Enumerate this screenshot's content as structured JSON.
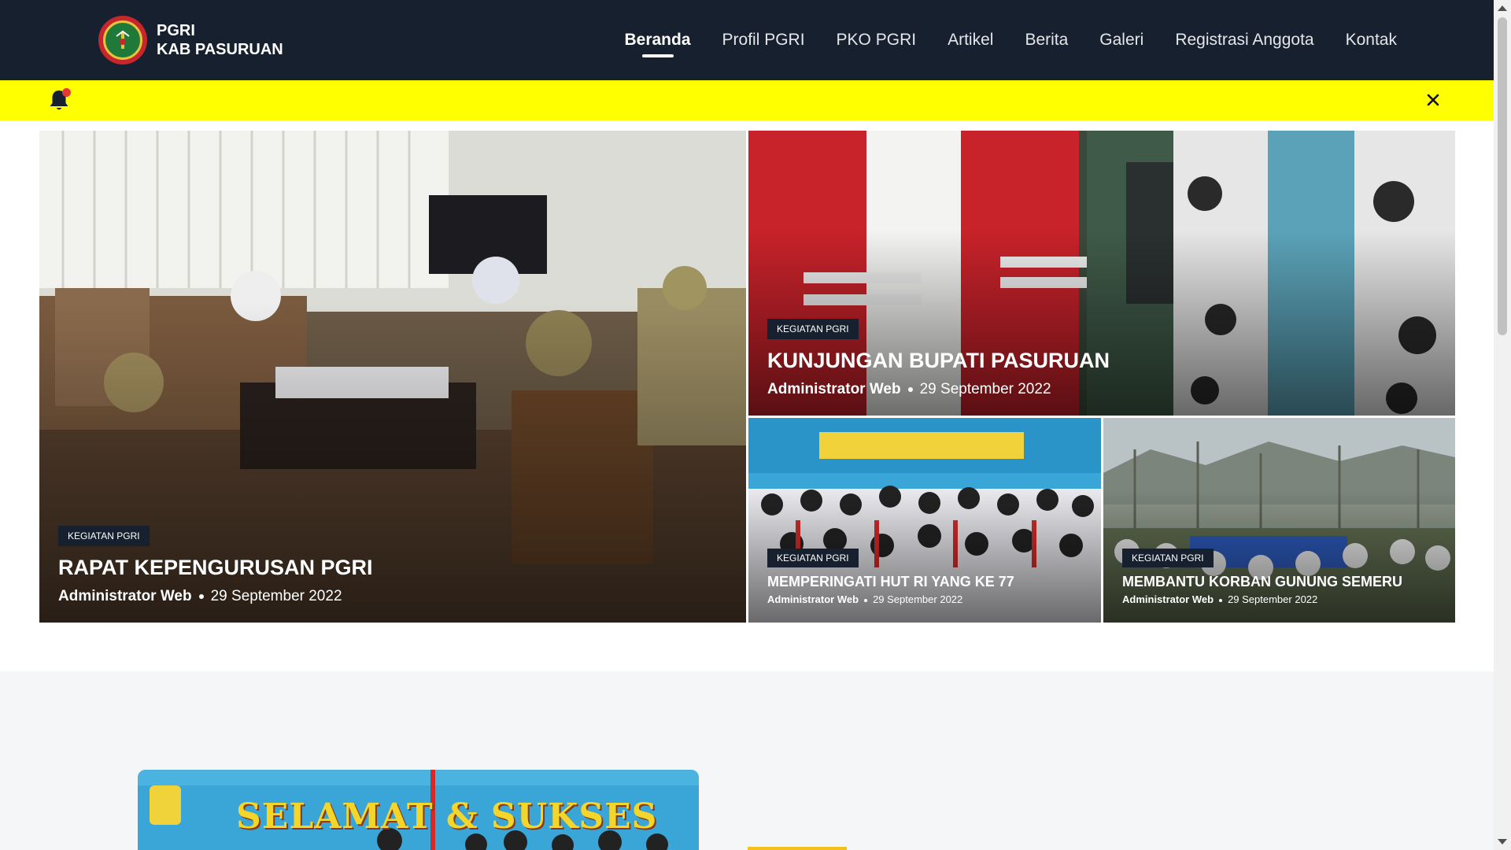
{
  "site": {
    "name_line1": "PGRI",
    "name_line2": "KAB PASURUAN",
    "logo_icon": "pgri-emblem"
  },
  "nav": {
    "items": [
      {
        "label": "Beranda",
        "active": true
      },
      {
        "label": "Profil PGRI"
      },
      {
        "label": "PKO PGRI"
      },
      {
        "label": "Artikel"
      },
      {
        "label": "Berita"
      },
      {
        "label": "Galeri"
      },
      {
        "label": "Registrasi Anggota"
      },
      {
        "label": "Kontak"
      }
    ]
  },
  "announcement": {
    "icon": "bell-icon",
    "close_icon": "close-icon",
    "background": "#ffff00"
  },
  "hero": {
    "main": {
      "category": "KEGIATAN PGRI",
      "title": "RAPAT KEPENGURUSAN PGRI",
      "author": "Administrator Web",
      "date": "29 September 2022"
    },
    "top": {
      "category": "KEGIATAN PGRI",
      "title": "KUNJUNGAN BUPATI PASURUAN",
      "author": "Administrator Web",
      "date": "29 September 2022"
    },
    "bottom_left": {
      "category": "KEGIATAN PGRI",
      "title": "MEMPERINGATI HUT RI YANG KE 77",
      "author": "Administrator Web",
      "date": "29 September 2022"
    },
    "bottom_right": {
      "category": "KEGIATAN PGRI",
      "title": "MEMBANTU KORBAN GUNUNG SEMERU",
      "author": "Administrator Web",
      "date": "29 September 2022"
    }
  },
  "lower": {
    "banner_text": "SELAMAT & SUKSES"
  },
  "colors": {
    "header_bg": "#16202e",
    "badge_bg": "#16202e",
    "accent": "#f2c21b"
  }
}
